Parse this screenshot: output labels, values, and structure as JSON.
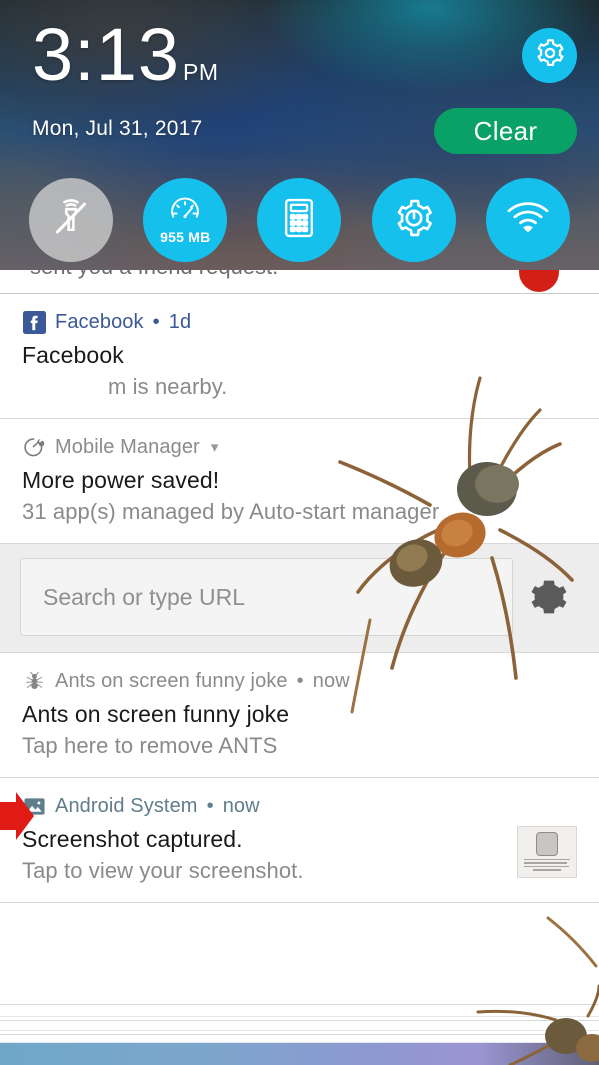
{
  "status_bar": {
    "time": "3:13",
    "am_pm": "PM",
    "date": "Mon, Jul 31, 2017"
  },
  "quick_settings": {
    "settings_icon": "gear-icon",
    "clear_label": "Clear",
    "toggles": [
      {
        "name": "flashlight",
        "icon": "flashlight-off-icon",
        "label": "",
        "state": "off",
        "color": "#cdcdcd"
      },
      {
        "name": "memory-boost",
        "icon": "speedometer-icon",
        "label": "955 MB",
        "state": "on",
        "color": "#16c0ec"
      },
      {
        "name": "calculator",
        "icon": "calculator-icon",
        "label": "",
        "state": "on",
        "color": "#16c0ec"
      },
      {
        "name": "settings-tuner",
        "icon": "gear-gauge-icon",
        "label": "",
        "state": "on",
        "color": "#16c0ec"
      },
      {
        "name": "wifi",
        "icon": "wifi-icon",
        "label": "",
        "state": "on",
        "color": "#16c0ec"
      }
    ]
  },
  "notifications": {
    "clipped_top": {
      "ghost_text": "sent you a friend request.",
      "badge_color": "#d32016"
    },
    "items": [
      {
        "app": "Facebook",
        "app_icon": "facebook-icon",
        "time": "1d",
        "title": "Facebook",
        "body": "m is nearby.",
        "body_indented": true,
        "expandable": false
      },
      {
        "app": "Mobile Manager",
        "app_icon": "mobile-manager-icon",
        "time": "",
        "title": "More power saved!",
        "body": "31 app(s) managed by Auto-start manager",
        "body_indented": false,
        "expandable": true
      },
      {
        "app": "Ants on screen funny joke",
        "app_icon": "ant-icon",
        "time": "now",
        "title": "Ants on screen funny joke",
        "body": "Tap here to remove ANTS",
        "body_indented": false,
        "expandable": false
      },
      {
        "app": "Android System",
        "app_icon": "image-icon",
        "time": "now",
        "title": "Screenshot captured.",
        "body": "Tap to view your screenshot.",
        "body_indented": false,
        "expandable": false,
        "has_thumbnail": true
      }
    ]
  },
  "browser_widget": {
    "placeholder": "Search or type URL",
    "value": "",
    "gear_icon": "gear-icon"
  },
  "colors": {
    "accent_cyan": "#16c0ec",
    "clear_green": "#09a166",
    "facebook_blue": "#3b5998",
    "arrow_red": "#e01b16",
    "badge_red": "#d32016"
  }
}
